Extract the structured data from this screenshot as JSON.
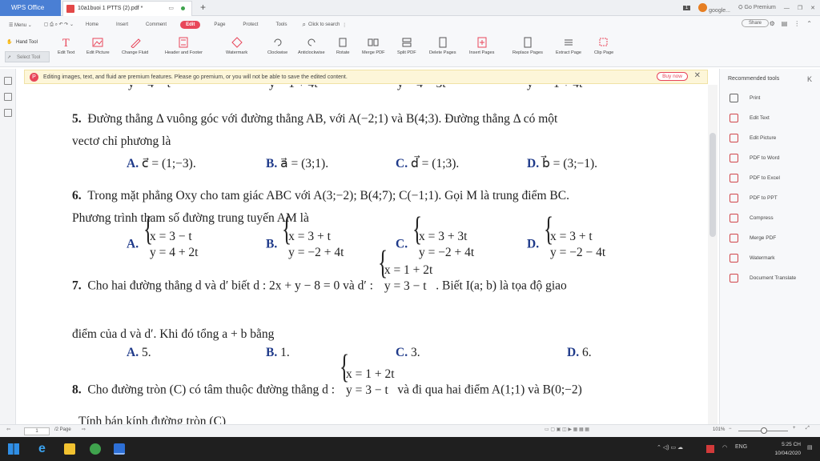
{
  "titlebar": {
    "app_name": "WPS Office",
    "doc_tab": "10a1buoi 1 PTTS (2).pdf *",
    "badge": "1",
    "account": "google...",
    "premium": "Go Premium"
  },
  "menu": {
    "items": [
      "Menu",
      "Home",
      "Insert",
      "Comment",
      "Edit",
      "Page",
      "Protect",
      "Tools"
    ],
    "search": "Click to search",
    "share": "Share"
  },
  "tools": {
    "hand": "Hand Tool",
    "select": "Select Tool",
    "items": [
      "Edit Text",
      "Edit Picture",
      "Change Fluid",
      "Header and Footer",
      "Watermark",
      "Clockwise",
      "Anticlockwise",
      "Rotate",
      "Merge PDF",
      "Split PDF",
      "Delete Pages",
      "Insert Pages",
      "Replace Pages",
      "Extract Page",
      "Clip Page"
    ]
  },
  "banner": {
    "text": "Editing images, text, and fluid are premium features. Please go premium, or you will not be able to save the edited content.",
    "buy": "Buy now"
  },
  "document": {
    "top_fragments": [
      "y = 4 − t",
      "y = 1 + 4t",
      "y = 4 − 3t",
      "y = −1 + 4t"
    ],
    "q5": {
      "num": "5.",
      "line1": "Đường thẳng Δ vuông góc với đường thẳng AB, với A(−2;1) và B(4;3). Đường thẳng Δ có một",
      "line2": "vectơ chỉ phương là",
      "opts": [
        {
          "label": "A.",
          "text": "c⃗ = (1;−3)."
        },
        {
          "label": "B.",
          "text": "a⃗ = (3;1)."
        },
        {
          "label": "C.",
          "text": "d⃗ = (1;3)."
        },
        {
          "label": "D.",
          "text": "b⃗ = (3;−1)."
        }
      ]
    },
    "q6": {
      "num": "6.",
      "line1": "Trong mặt phẳng Oxy cho tam giác ABC với A(3;−2); B(4;7); C(−1;1). Gọi M là trung điểm BC.",
      "line2": "Phương trình tham số đường trung tuyến AM là",
      "opts": [
        {
          "label": "A.",
          "r1": "x = 3 − t",
          "r2": "y = 4 + 2t"
        },
        {
          "label": "B.",
          "r1": "x = 3 + t",
          "r2": "y = −2 + 4t"
        },
        {
          "label": "C.",
          "r1": "x = 3 + 3t",
          "r2": "y = −2 + 4t"
        },
        {
          "label": "D.",
          "r1": "x = 3 + t",
          "r2": "y = −2 − 4t"
        }
      ]
    },
    "q7": {
      "num": "7.",
      "pre": "Cho hai đường thẳng d và d′ biết d : 2x + y − 8 = 0 và d′ :",
      "sys_r1": "x = 1 + 2t",
      "sys_r2": "y = 3 − t",
      "post": ". Biết I(a; b) là tọa độ giao",
      "line2": "điểm của d và d′. Khi đó tổng a + b bằng",
      "opts": [
        {
          "label": "A.",
          "text": "5."
        },
        {
          "label": "B.",
          "text": "1."
        },
        {
          "label": "C.",
          "text": "3."
        },
        {
          "label": "D.",
          "text": "6."
        }
      ]
    },
    "q8": {
      "num": "8.",
      "pre": "Cho đường tròn (C) có tâm thuộc đường thẳng d :",
      "sys_r1": "x = 1 + 2t",
      "sys_r2": "y = 3 − t",
      "post": "và đi qua hai điểm A(1;1) và B(0;−2)",
      "line2": "Tính bán kính đường tròn (C)"
    }
  },
  "recommended": {
    "title": "Recommended tools",
    "collapse": "K",
    "items": [
      "Print",
      "Edit Text",
      "Edit Picture",
      "PDF to Word",
      "PDF to Excel",
      "PDF to PPT",
      "Compress",
      "Merge PDF",
      "Watermark",
      "Document Translate"
    ]
  },
  "status": {
    "page": "1",
    "pages": "/2 Page",
    "zoom": "101%"
  },
  "taskbar": {
    "lang": "ENG",
    "time": "5:25 CH",
    "date": "10/04/2020"
  }
}
